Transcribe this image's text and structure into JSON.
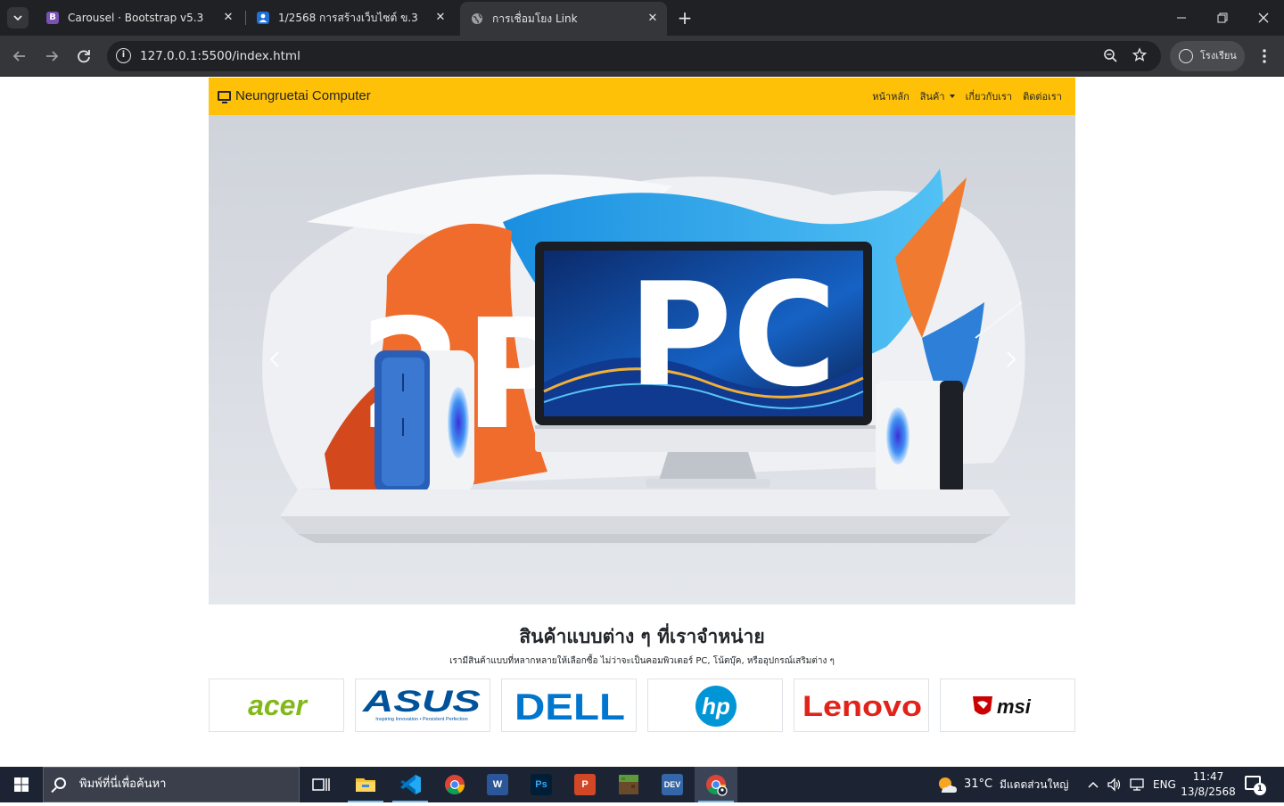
{
  "browser": {
    "tabs": [
      {
        "title": "Carousel · Bootstrap v5.3",
        "favicon": "bootstrap-icon",
        "favicon_text": "B",
        "favicon_color": "#7952b3",
        "active": false
      },
      {
        "title": "1/2568 การสร้างเว็บไซต์ ข.3",
        "favicon": "classroom-icon",
        "favicon_text": "👤",
        "favicon_color": "#1e6fd9",
        "active": false
      },
      {
        "title": "การเชื่อมโยง Link",
        "favicon": "globe-icon",
        "favicon_text": "◍",
        "favicon_color": "#35363a",
        "active": true
      }
    ],
    "address": "127.0.0.1:5500/index.html",
    "profile_name": "โรงเรียน"
  },
  "page": {
    "navbar": {
      "brand": "Neungruetai Computer",
      "links": [
        {
          "label": "หน้าหลัก",
          "dropdown": false
        },
        {
          "label": "สินค้า",
          "dropdown": true
        },
        {
          "label": "เกี่ยวกับเรา",
          "dropdown": false
        },
        {
          "label": "ติดต่อเรา",
          "dropdown": false
        }
      ],
      "color": "#ffc107"
    },
    "carousel": {
      "slide_text_left": "2P",
      "slide_text_right": "PC",
      "prev_icon": "chevron-left-icon",
      "next_icon": "chevron-right-icon"
    },
    "products": {
      "title": "สินค้าแบบต่าง ๆ ที่เราจำหน่าย",
      "subtitle": "เรามีสินค้าแบบที่หลากหลายให้เลือกซื้อ ไม่ว่าจะเป็นคอมพิวเตอร์ PC, โน้ตบุ๊ค, หรืออุปกรณ์เสริมต่าง ๆ",
      "brands": [
        {
          "name": "acer",
          "color": "#83b81a"
        },
        {
          "name": "ASUS",
          "tagline": "Inspiring Innovation • Persistent Perfection",
          "color": "#00539b"
        },
        {
          "name": "DELL",
          "color": "#0076ce"
        },
        {
          "name": "hp",
          "color": "#0096d6"
        },
        {
          "name": "Lenovo",
          "color": "#e2231a"
        },
        {
          "name": "msi",
          "color": "#cc0000"
        }
      ]
    }
  },
  "taskbar": {
    "search_placeholder": "พิมพ์ที่นี่เพื่อค้นหา",
    "apps": [
      {
        "name": "task-view-icon"
      },
      {
        "name": "file-explorer-icon"
      },
      {
        "name": "vscode-icon"
      },
      {
        "name": "chrome-icon"
      },
      {
        "name": "word-icon",
        "text": "W"
      },
      {
        "name": "photoshop-icon",
        "text": "Ps"
      },
      {
        "name": "powerpoint-icon",
        "text": "P"
      },
      {
        "name": "minecraft-icon"
      },
      {
        "name": "devcpp-icon",
        "text": "DEV"
      },
      {
        "name": "chrome-profile-icon"
      }
    ],
    "weather": {
      "temp": "31°C",
      "condition": "มีแดดส่วนใหญ่"
    },
    "language": "ENG",
    "time": "11:47",
    "date": "13/8/2568",
    "notifications": "1"
  }
}
